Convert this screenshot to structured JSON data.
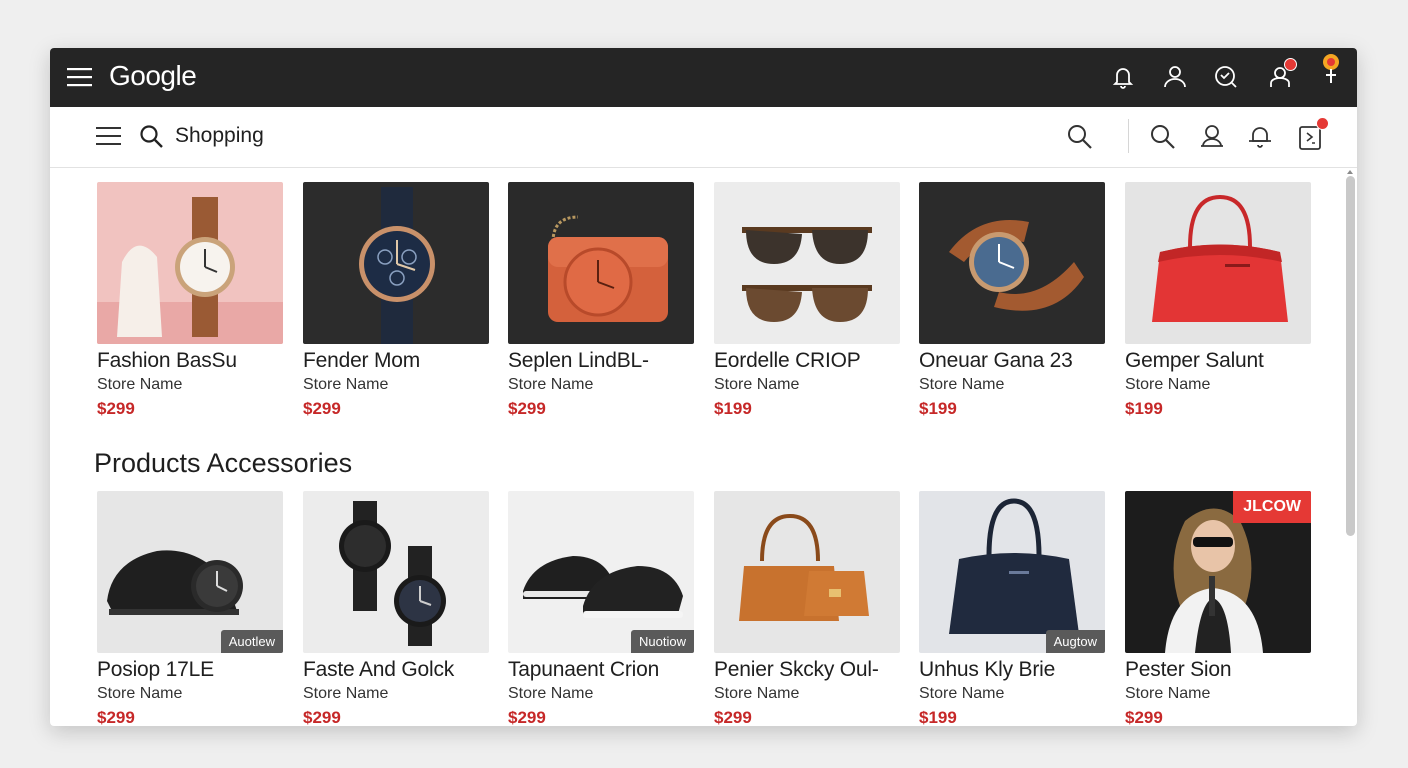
{
  "app": {
    "logo": "Google"
  },
  "subbar": {
    "title": "Shopping"
  },
  "topbar_icons": [
    "bell-icon",
    "user-icon",
    "chat-heart-icon",
    "user-alert-icon",
    "pin-icon"
  ],
  "subbar_icons": [
    "search-icon",
    "search-icon",
    "user-icon",
    "bell-icon",
    "document-icon"
  ],
  "section": {
    "title": "Products Accessories"
  },
  "row1": [
    {
      "name": "Fashion BasSu",
      "store": "Store Name",
      "price": "$299"
    },
    {
      "name": "Fender Mom",
      "store": "Store Name",
      "price": "$299"
    },
    {
      "name": "Seplen LindBL-",
      "store": "Store Name",
      "price": "$299"
    },
    {
      "name": "Eordelle CRIOP",
      "store": "Store Name",
      "price": "$199"
    },
    {
      "name": "Oneuar Gana 23",
      "store": "Store Name",
      "price": "$199"
    },
    {
      "name": "Gemper Salunt",
      "store": "Store Name",
      "price": "$199"
    }
  ],
  "row2": [
    {
      "name": "Posiop 17LE",
      "store": "Store Name",
      "price": "$299",
      "tag": "Auotlew"
    },
    {
      "name": "Faste And Golck",
      "store": "Store Name",
      "price": "$299"
    },
    {
      "name": "Tapunaent Crion",
      "store": "Store Name",
      "price": "$299",
      "tag": "Nuotiow"
    },
    {
      "name": "Penier Skcky Oul-",
      "store": "Store Name",
      "price": "$299"
    },
    {
      "name": "Unhus Kly Brie",
      "store": "Store Name",
      "price": "$199",
      "tag": "Augtow"
    },
    {
      "name": "Pester Sion",
      "store": "Store Name",
      "price": "$299",
      "tag": "JLCOW"
    }
  ],
  "colors": {
    "topbar": "#252525",
    "price": "#c62828",
    "badge": "#e53935"
  }
}
